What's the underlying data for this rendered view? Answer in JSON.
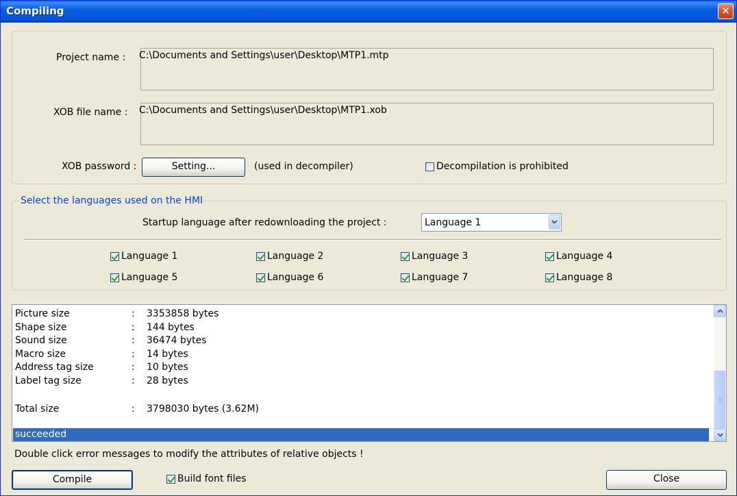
{
  "window": {
    "title": "Compiling",
    "close_glyph": "✕"
  },
  "project": {
    "project_name_label": "Project name :",
    "project_name_value": "C:\\Documents and Settings\\user\\Desktop\\MTP1.mtp",
    "xob_file_label": "XOB file name :",
    "xob_file_value": "C:\\Documents and Settings\\user\\Desktop\\MTP1.xob",
    "xob_password_label": "XOB password :",
    "setting_button": "Setting...",
    "setting_note": "(used in decompiler)",
    "decompile_prohibited": {
      "label": "Decompilation is prohibited",
      "checked": false
    }
  },
  "languages": {
    "group_title": "Select the languages used on the HMI",
    "startup_label": "Startup language after redownloading the project :",
    "startup_value": "Language 1",
    "items": [
      {
        "label": "Language 1",
        "checked": true
      },
      {
        "label": "Language 2",
        "checked": true
      },
      {
        "label": "Language 3",
        "checked": true
      },
      {
        "label": "Language 4",
        "checked": true
      },
      {
        "label": "Language 5",
        "checked": true
      },
      {
        "label": "Language 6",
        "checked": true
      },
      {
        "label": "Language 7",
        "checked": true
      },
      {
        "label": "Language 8",
        "checked": true
      }
    ]
  },
  "log": {
    "rows": [
      {
        "key": "Picture size",
        "sep": ":",
        "value": "3353858 bytes"
      },
      {
        "key": "Shape size",
        "sep": ":",
        "value": "144 bytes"
      },
      {
        "key": "Sound size",
        "sep": ":",
        "value": "36474 bytes"
      },
      {
        "key": "Macro size",
        "sep": ":",
        "value": "14 bytes"
      },
      {
        "key": "Address tag size",
        "sep": ":",
        "value": "10 bytes"
      },
      {
        "key": "Label tag size",
        "sep": ":",
        "value": "28 bytes"
      }
    ],
    "total": {
      "key": "Total size",
      "sep": ":",
      "value": "3798030 bytes (3.62M)"
    },
    "status": "succeeded"
  },
  "hint": "Double click error messages to modify the attributes of relative objects !",
  "footer": {
    "compile_button": "Compile",
    "build_font": {
      "label": "Build font files",
      "checked": true
    },
    "close_button": "Close"
  },
  "colors": {
    "title_bar": "#0a5ee0",
    "legend_text": "#0046d5",
    "selection": "#316ac5",
    "check_mark": "#21a121"
  }
}
